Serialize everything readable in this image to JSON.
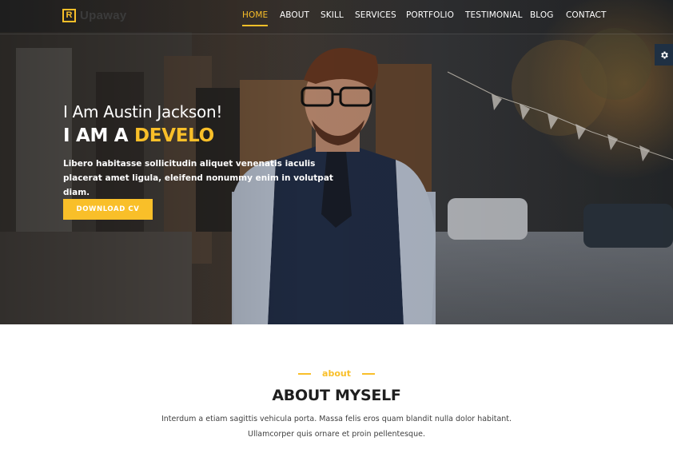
{
  "brand": {
    "logo_letter": "R",
    "name": "Upaway",
    "accent_color": "#f9bf29"
  },
  "nav": {
    "items": [
      {
        "label": "HOME",
        "active": true
      },
      {
        "label": "ABOUT",
        "active": false
      },
      {
        "label": "SKILL",
        "active": false
      },
      {
        "label": "SERVICES",
        "active": false
      },
      {
        "label": "PORTFOLIO",
        "active": false
      },
      {
        "label": "TESTIMONIAL",
        "active": false
      },
      {
        "label": "BLOG",
        "active": false
      },
      {
        "label": "CONTACT",
        "active": false
      }
    ]
  },
  "settings": {
    "icon": "gear-icon"
  },
  "hero": {
    "subtitle": "I Am Austin Jackson!",
    "title_prefix": "I AM A",
    "title_highlight": "DEVELO",
    "description": "Libero habitasse sollicitudin aliquet venenatis iaculis placerat amet ligula, eleifend nonummy enim in volutpat diam.",
    "button_label": "DOWNLOAD CV"
  },
  "about": {
    "kicker": "about",
    "title": "ABOUT MYSELF",
    "text_line1": "Interdum a etiam sagittis vehicula porta. Massa felis eros quam blandit nulla dolor habitant.",
    "text_line2": "Ullamcorper quis ornare et proin pellentesque."
  }
}
